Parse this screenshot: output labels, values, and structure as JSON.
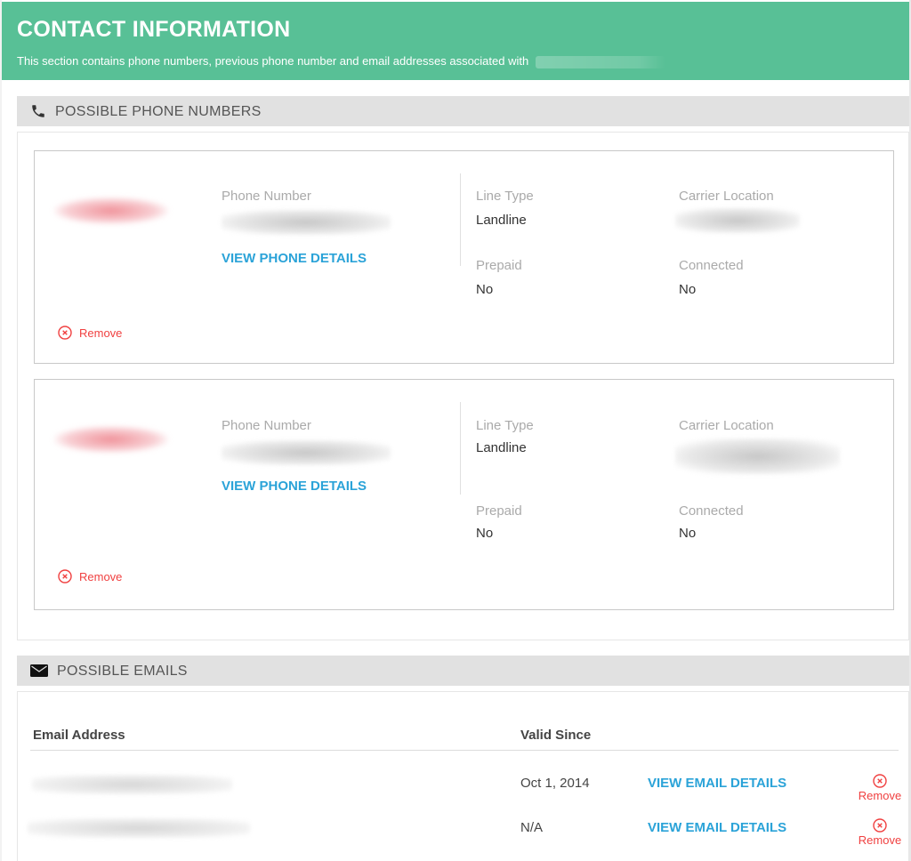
{
  "header": {
    "title": "CONTACT INFORMATION",
    "description": "This section contains phone numbers, previous phone number and email addresses associated with",
    "brand_color": "#58c096"
  },
  "phones_section": {
    "title": "POSSIBLE PHONE NUMBERS",
    "icon": "phone-icon",
    "cards": [
      {
        "carrier_logo": "redacted",
        "phone_number_label": "Phone Number",
        "phone_number": "redacted",
        "details_link": "VIEW PHONE DETAILS",
        "line_type_label": "Line Type",
        "line_type": "Landline",
        "carrier_location_label": "Carrier Location",
        "carrier_location": "redacted",
        "prepaid_label": "Prepaid",
        "prepaid": "No",
        "connected_label": "Connected",
        "connected": "No",
        "remove_label": "Remove"
      },
      {
        "carrier_logo": "redacted",
        "phone_number_label": "Phone Number",
        "phone_number": "redacted",
        "details_link": "VIEW PHONE DETAILS",
        "line_type_label": "Line Type",
        "line_type": "Landline",
        "carrier_location_label": "Carrier Location",
        "carrier_location": "redacted",
        "prepaid_label": "Prepaid",
        "prepaid": "No",
        "connected_label": "Connected",
        "connected": "No",
        "remove_label": "Remove"
      }
    ]
  },
  "emails_section": {
    "title": "POSSIBLE EMAILS",
    "icon": "envelope-icon",
    "columns": [
      "Email Address",
      "Valid Since"
    ],
    "rows": [
      {
        "email": "redacted",
        "valid_since": "Oct 1, 2014",
        "details_link": "VIEW EMAIL DETAILS",
        "remove_label": "Remove"
      },
      {
        "email": "redacted",
        "valid_since": "N/A",
        "details_link": "VIEW EMAIL DETAILS",
        "remove_label": "Remove"
      }
    ]
  },
  "colors": {
    "link": "#2ba3d8",
    "remove": "#f04040",
    "section_header_bg": "#e1e1e1"
  }
}
